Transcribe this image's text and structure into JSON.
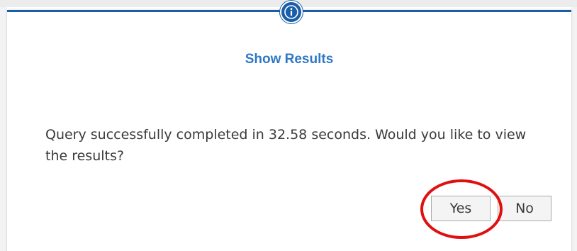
{
  "dialog": {
    "title": "Show Results",
    "icon": "info-icon",
    "accent_color": "#1a5ea8",
    "title_color": "#2f78c4",
    "message": "Query successfully completed in 32.58 seconds. Would you like to view the results?"
  },
  "buttons": {
    "yes_label": "Yes",
    "no_label": "No"
  },
  "annotation": {
    "highlight": "red-circle-around-yes",
    "color": "#e01010"
  }
}
